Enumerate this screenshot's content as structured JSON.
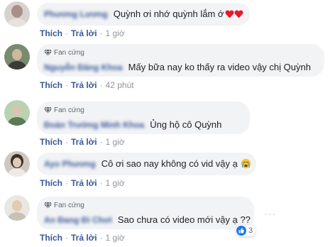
{
  "comments": [
    {
      "author": "Phương Lương",
      "badge": "",
      "text": "Quỳnh ơi nhớ quỳnh lắm ớ",
      "hearts": 2,
      "like": "Thích",
      "reply": "Trả lời",
      "time": "1 giờ"
    },
    {
      "author": "Nguyễn Đăng Khoa",
      "badge": "Fan cứng",
      "text": "Mấy bữa nay ko thấy ra video vậy chị Quỳnh",
      "like": "Thích",
      "reply": "Trả lời",
      "time": "42 phút"
    },
    {
      "author": "Đoàn Trường Minh Khoa",
      "badge": "Fan cứng",
      "text": "Ủng hộ cô Quỳnh",
      "like": "Thích",
      "reply": "Trả lời",
      "time": "1 giờ"
    },
    {
      "author": "Ayo Phương",
      "badge": "",
      "text": "Cô ơi sao nay không có vid vậy ạ",
      "emoji": "crying-face",
      "like": "Thích",
      "reply": "Trả lời",
      "time": "1 giờ"
    },
    {
      "author": "An Đang Đi Chơi",
      "badge": "Fan cứng",
      "text": "Sao chưa có video mới vậy ạ ??",
      "like": "Thích",
      "reply": "Trả lời",
      "time": "1 giờ",
      "reactions": "3",
      "more": "···"
    }
  ],
  "icons": {
    "badge": "diamond-icon",
    "reaction": "like-icon",
    "heart_color": "#e8192c",
    "link_color": "#385898",
    "bubble_color": "#f2f3f5"
  }
}
